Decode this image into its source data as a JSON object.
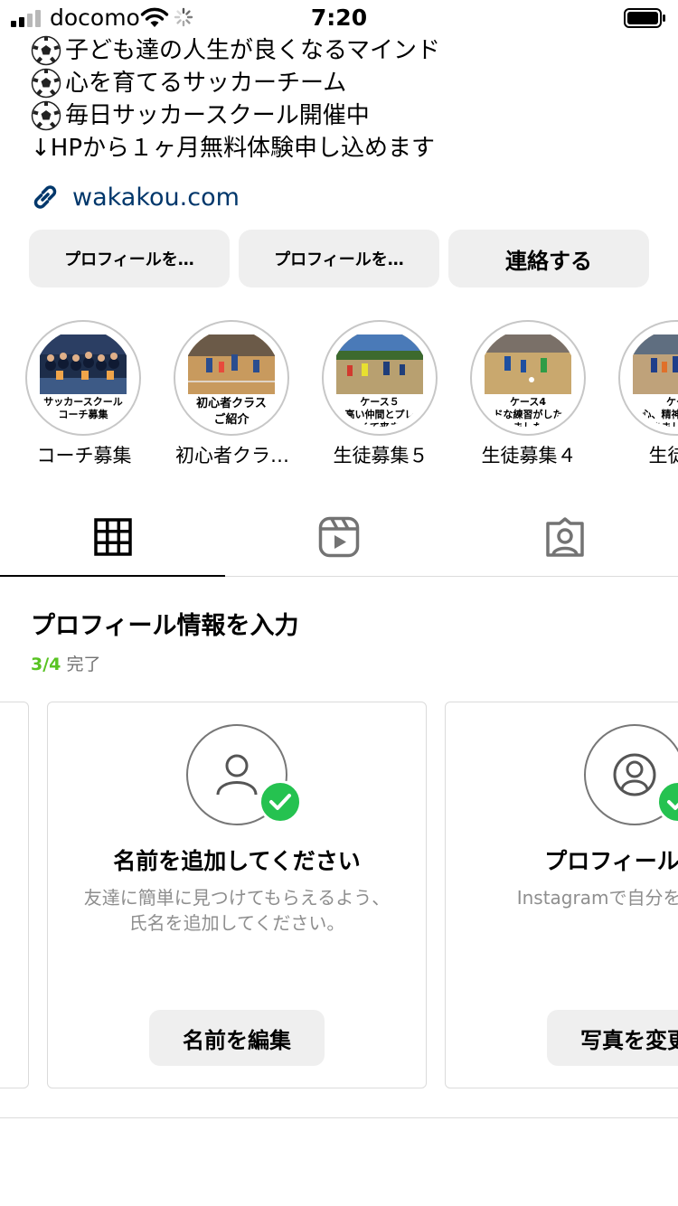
{
  "status_bar": {
    "carrier": "docomo",
    "time": "7:20"
  },
  "bio": {
    "lines": [
      "子ども達の人生が良くなるマインド",
      "心を育てるサッカーチーム",
      "毎日サッカースクール開催中",
      "↓HPから１ヶ月無料体験申し込めます"
    ],
    "link": "wakakou.com"
  },
  "actions": {
    "edit_profile_1": "プロフィールを…",
    "edit_profile_2": "プロフィールを…",
    "contact": "連絡する"
  },
  "highlights": [
    {
      "label": "コーチ募集",
      "caption": "サッカースクール\nコーチ募集"
    },
    {
      "label": "初心者クラ…",
      "caption": "初心者クラス\nご紹介"
    },
    {
      "label": "生徒募集５",
      "caption": "ケース５\nの高い仲間とプレー\nたくて来まし"
    },
    {
      "label": "生徒募集４",
      "caption": "ケース4\nードな練習がしたく\nました"
    },
    {
      "label": "生徒募",
      "caption": "ケー\n心、精神面を強\nきました。"
    }
  ],
  "tabs": [
    "grid-tab",
    "reels-tab",
    "tagged-tab"
  ],
  "profile_info": {
    "title": "プロフィール情報を入力",
    "progress": "3/4",
    "progress_suffix": "完了",
    "progress_fraction": 0.75,
    "cards": [
      {
        "title": "名前を追加してください",
        "description": "友達に簡単に見つけてもらえるよう、氏名を追加してください。",
        "button": "名前を編集",
        "completed": true
      },
      {
        "title": "プロフィール写真",
        "description": "Instagramで自分を選ぼう。",
        "button": "写真を変更",
        "completed": true
      }
    ]
  },
  "colors": {
    "link": "#00376b",
    "progress_green": "#58c322",
    "check_green": "#25c250",
    "button_bg": "#efefef"
  }
}
